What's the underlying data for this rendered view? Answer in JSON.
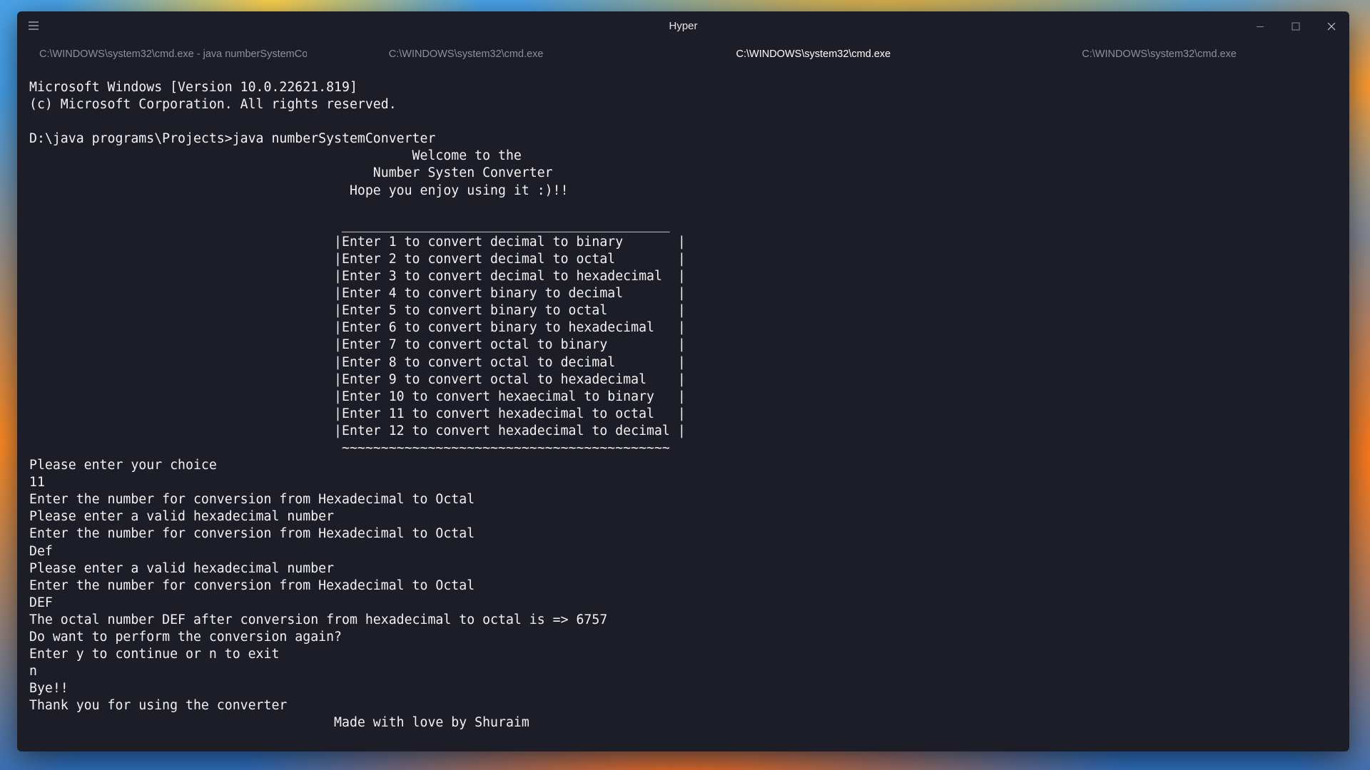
{
  "window": {
    "title": "Hyper",
    "menu_icon": "hamburger-menu-icon",
    "controls": [
      "minimize-icon",
      "maximize-icon",
      "close-icon"
    ]
  },
  "tabs": [
    {
      "label": "C:\\WINDOWS\\system32\\cmd.exe - java numberSystemCon...",
      "active": false
    },
    {
      "label": "C:\\WINDOWS\\system32\\cmd.exe",
      "active": false
    },
    {
      "label": "C:\\WINDOWS\\system32\\cmd.exe",
      "active": true
    },
    {
      "label": "C:\\WINDOWS\\system32\\cmd.exe",
      "active": false
    }
  ],
  "terminal": {
    "lines": [
      "Microsoft Windows [Version 10.0.22621.819]",
      "(c) Microsoft Corporation. All rights reserved.",
      "",
      "D:\\java programs\\Projects>java numberSystemConverter",
      "                                                 Welcome to the",
      "                                            Number Systen Converter",
      "                                         Hope you enjoy using it :)!!",
      "",
      "                                        __________________________________________",
      "                                       |Enter 1 to convert decimal to binary       |",
      "                                       |Enter 2 to convert decimal to octal        |",
      "                                       |Enter 3 to convert decimal to hexadecimal  |",
      "                                       |Enter 4 to convert binary to decimal       |",
      "                                       |Enter 5 to convert binary to octal         |",
      "                                       |Enter 6 to convert binary to hexadecimal   |",
      "                                       |Enter 7 to convert octal to binary         |",
      "                                       |Enter 8 to convert octal to decimal        |",
      "                                       |Enter 9 to convert octal to hexadecimal    |",
      "                                       |Enter 10 to convert hexaecimal to binary   |",
      "                                       |Enter 11 to convert hexadecimal to octal   |",
      "                                       |Enter 12 to convert hexadecimal to decimal |",
      "                                        ~~~~~~~~~~~~~~~~~~~~~~~~~~~~~~~~~~~~~~~~~~",
      "Please enter your choice",
      "11",
      "Enter the number for conversion from Hexadecimal to Octal",
      "Please enter a valid hexadecimal number",
      "Enter the number for conversion from Hexadecimal to Octal",
      "Def",
      "Please enter a valid hexadecimal number",
      "Enter the number for conversion from Hexadecimal to Octal",
      "DEF",
      "The octal number DEF after conversion from hexadecimal to octal is => 6757",
      "Do want to perform the conversion again?",
      "Enter y to continue or n to exit",
      "n",
      "Bye!!",
      "Thank you for using the converter",
      "                                       Made with love by Shuraim"
    ]
  }
}
